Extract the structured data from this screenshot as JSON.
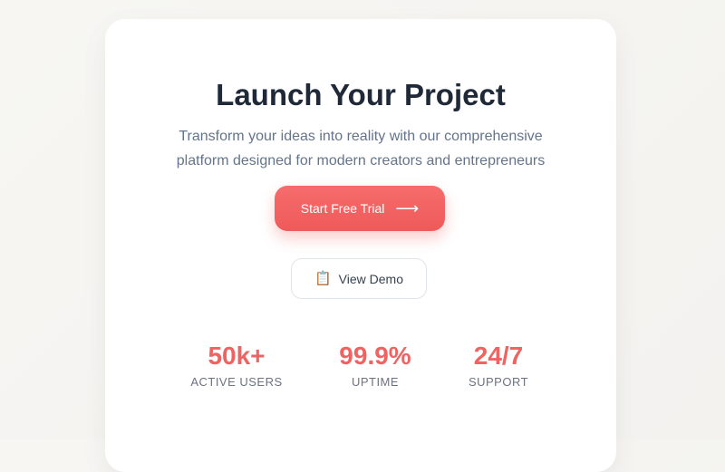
{
  "hero": {
    "title": "Launch Your Project",
    "subtitle_line1": "Transform your ideas into reality with our comprehensive",
    "subtitle_line2": "platform designed for modern creators and entrepreneurs"
  },
  "actions": {
    "primary_label": "Start Free Trial",
    "primary_icon": "arrow-right-icon",
    "secondary_label": "View Demo",
    "secondary_icon": "clipboard-icon"
  },
  "stats": [
    {
      "value": "50k+",
      "label": "ACTIVE USERS"
    },
    {
      "value": "99.9%",
      "label": "UPTIME"
    },
    {
      "value": "24/7",
      "label": "SUPPORT"
    }
  ],
  "colors": {
    "accent": "#ef5a5a",
    "title": "#1f2937",
    "muted": "#64748b"
  }
}
